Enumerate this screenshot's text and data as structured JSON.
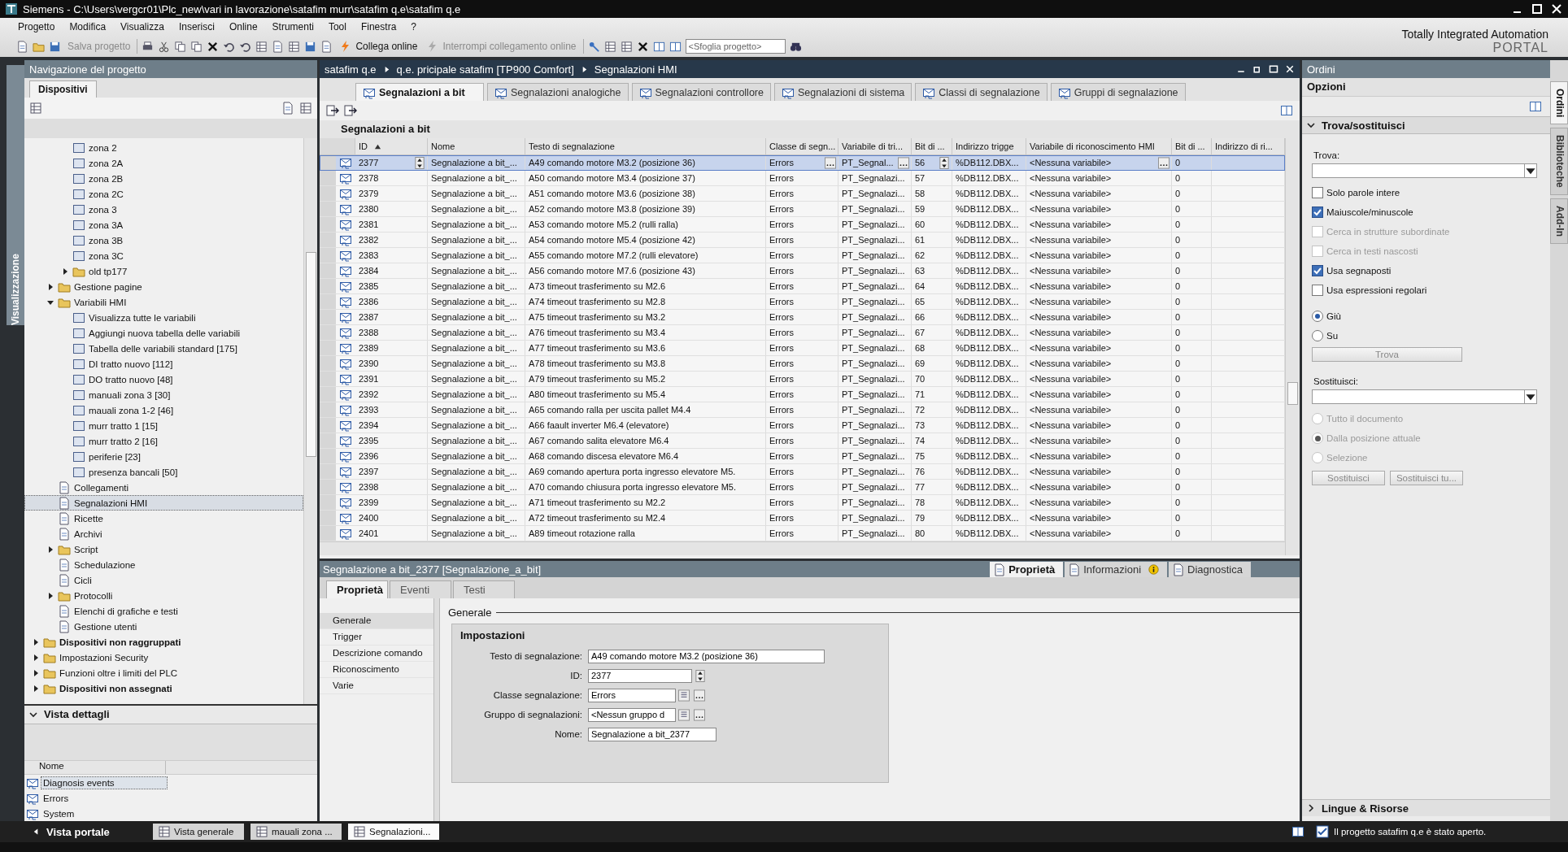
{
  "window": {
    "title": "Siemens  -  C:\\Users\\vergcr01\\Plc_new\\vari in lavorazione\\satafim murr\\satafim q.e\\satafim q.e"
  },
  "menu": [
    "Progetto",
    "Modifica",
    "Visualizza",
    "Inserisci",
    "Online",
    "Strumenti",
    "Tool",
    "Finestra",
    "?"
  ],
  "toolbar": {
    "items": [
      {
        "label": "Salva progetto",
        "disabled": true
      },
      {
        "label": "Collega online",
        "disabled": false
      },
      {
        "label": "Interrompi collegamento online",
        "disabled": true
      }
    ],
    "search": {
      "placeholder": "<Sfoglia progetto>"
    }
  },
  "brand": {
    "line1": "Totally Integrated Automation",
    "line2": "PORTAL"
  },
  "side_strip": {
    "label": "Visualizzazione"
  },
  "navigation": {
    "title": "Navigazione del progetto",
    "tab": "Dispositivi",
    "tree": [
      {
        "children": [
          {
            "children": [
              {
                "label": "zona 2",
                "selected": false
              },
              {
                "label": "zona 2A",
                "selected": false
              },
              {
                "label": "zona 2B",
                "selected": false
              },
              {
                "label": "zona 2C",
                "selected": false
              },
              {
                "label": "zona 3",
                "selected": false
              },
              {
                "label": "zona 3A",
                "selected": false
              },
              {
                "label": "zona 3B",
                "selected": false
              },
              {
                "label": "zona 3C",
                "selected": false
              },
              {
                "label": "old tp177",
                "expanded": false,
                "selected": false
              }
            ]
          },
          {
            "label": "Gestione pagine",
            "expanded": false,
            "selected": false
          },
          {
            "label": "Variabili HMI",
            "expanded": true,
            "selected": false,
            "children": [
              {
                "label": "Visualizza tutte le variabili",
                "selected": false
              },
              {
                "label": "Aggiungi nuova tabella delle variabili",
                "selected": false
              },
              {
                "label": "Tabella delle variabili standard [175]",
                "selected": false
              },
              {
                "label": "DI tratto nuovo [112]",
                "selected": false
              },
              {
                "label": "DO tratto nuovo [48]",
                "selected": false
              },
              {
                "label": "manuali zona 3 [30]",
                "selected": false
              },
              {
                "label": "mauali zona 1-2 [46]",
                "selected": false
              },
              {
                "label": "murr tratto 1 [15]",
                "selected": false
              },
              {
                "label": "murr tratto 2 [16]",
                "selected": false
              },
              {
                "label": "periferie [23]",
                "selected": false
              },
              {
                "label": "presenza bancali [50]",
                "selected": false
              }
            ]
          },
          {
            "label": "Collegamenti",
            "selected": false
          },
          {
            "label": "Segnalazioni HMI",
            "selected": true
          },
          {
            "label": "Ricette",
            "selected": false
          },
          {
            "label": "Archivi",
            "selected": false
          },
          {
            "label": "Script",
            "expanded": false,
            "selected": false
          },
          {
            "label": "Schedulazione",
            "selected": false
          },
          {
            "label": "Cicli",
            "selected": false
          },
          {
            "label": "Protocolli",
            "expanded": false,
            "selected": false
          },
          {
            "label": "Elenchi di grafiche e testi",
            "selected": false
          },
          {
            "label": "Gestione utenti",
            "selected": false
          }
        ]
      },
      {
        "label": "Dispositivi non raggruppati",
        "bold": true,
        "expanded": false,
        "selected": false
      },
      {
        "label": "Impostazioni Security",
        "bold": false,
        "expanded": false,
        "selected": false
      },
      {
        "label": "Funzioni oltre i limiti del PLC",
        "bold": false,
        "expanded": false,
        "selected": false
      },
      {
        "label": "Dispositivi non assegnati",
        "bold": true,
        "expanded": false,
        "selected": false
      }
    ]
  },
  "details": {
    "title": "Vista dettagli",
    "column": "Nome",
    "rows": [
      {
        "label": "Diagnosis events",
        "selected": true
      },
      {
        "label": "Errors",
        "selected": false
      },
      {
        "label": "System",
        "selected": false
      }
    ]
  },
  "editor": {
    "breadcrumb": [
      "satafim q.e",
      "q.e. pricipale satafim [TP900 Comfort]",
      "Segnalazioni HMI"
    ],
    "tabs": [
      {
        "label": "Segnalazioni a bit",
        "selected": true
      },
      {
        "label": "Segnalazioni analogiche",
        "selected": false
      },
      {
        "label": "Segnalazioni controllore",
        "selected": false
      },
      {
        "label": "Segnalazioni di sistema",
        "selected": false
      },
      {
        "label": "Classi di segnalazione",
        "selected": false
      },
      {
        "label": "Gruppi di segnalazione",
        "selected": false
      }
    ],
    "caption": "Segnalazioni a bit"
  },
  "table": {
    "columns": [
      "ID",
      "Nome",
      "Testo di segnalazione",
      "Classe di segn...",
      "Variabile di tri...",
      "Bit di ...",
      "Indirizzo trigge",
      "Variabile di riconoscimento HMI",
      "Bit di ...",
      "Indirizzo di ri..."
    ],
    "rows": [
      {
        "selected": true,
        "id": "2377",
        "name": "Segnalazione a bit_...",
        "text": "A49 comando motore M3.2 (posizione 36)",
        "class": "Errors",
        "trigger_tag": "PT_Segnal...",
        "trigger_bit": "56",
        "trigger_address": "%DB112.DBX...",
        "ack_tag": "<Nessuna variabile>",
        "ack_bit": "0"
      },
      {
        "selected": false,
        "id": "2378",
        "name": "Segnalazione a bit_...",
        "text": "A50 comando motore M3.4 (posizione 37)",
        "class": "Errors",
        "trigger_tag": "PT_Segnalazi...",
        "trigger_bit": "57",
        "trigger_address": "%DB112.DBX...",
        "ack_tag": "<Nessuna variabile>",
        "ack_bit": "0"
      },
      {
        "selected": false,
        "id": "2379",
        "name": "Segnalazione a bit_...",
        "text": "A51 comando motore M3.6 (posizione 38)",
        "class": "Errors",
        "trigger_tag": "PT_Segnalazi...",
        "trigger_bit": "58",
        "trigger_address": "%DB112.DBX...",
        "ack_tag": "<Nessuna variabile>",
        "ack_bit": "0"
      },
      {
        "selected": false,
        "id": "2380",
        "name": "Segnalazione a bit_...",
        "text": "A52 comando motore M3.8 (posizione 39)",
        "class": "Errors",
        "trigger_tag": "PT_Segnalazi...",
        "trigger_bit": "59",
        "trigger_address": "%DB112.DBX...",
        "ack_tag": "<Nessuna variabile>",
        "ack_bit": "0"
      },
      {
        "selected": false,
        "id": "2381",
        "name": "Segnalazione a bit_...",
        "text": "A53 comando motore M5.2 (rulli ralla)",
        "class": "Errors",
        "trigger_tag": "PT_Segnalazi...",
        "trigger_bit": "60",
        "trigger_address": "%DB112.DBX...",
        "ack_tag": "<Nessuna variabile>",
        "ack_bit": "0"
      },
      {
        "selected": false,
        "id": "2382",
        "name": "Segnalazione a bit_...",
        "text": "A54 comando motore M5.4 (posizione 42)",
        "class": "Errors",
        "trigger_tag": "PT_Segnalazi...",
        "trigger_bit": "61",
        "trigger_address": "%DB112.DBX...",
        "ack_tag": "<Nessuna variabile>",
        "ack_bit": "0"
      },
      {
        "selected": false,
        "id": "2383",
        "name": "Segnalazione a bit_...",
        "text": "A55 comando motore M7.2 (rulli elevatore)",
        "class": "Errors",
        "trigger_tag": "PT_Segnalazi...",
        "trigger_bit": "62",
        "trigger_address": "%DB112.DBX...",
        "ack_tag": "<Nessuna variabile>",
        "ack_bit": "0"
      },
      {
        "selected": false,
        "id": "2384",
        "name": "Segnalazione a bit_...",
        "text": "A56 comando motore M7.6 (posizione 43)",
        "class": "Errors",
        "trigger_tag": "PT_Segnalazi...",
        "trigger_bit": "63",
        "trigger_address": "%DB112.DBX...",
        "ack_tag": "<Nessuna variabile>",
        "ack_bit": "0"
      },
      {
        "selected": false,
        "id": "2385",
        "name": "Segnalazione a bit_...",
        "text": "A73 timeout trasferimento su M2.6",
        "class": "Errors",
        "trigger_tag": "PT_Segnalazi...",
        "trigger_bit": "64",
        "trigger_address": "%DB112.DBX...",
        "ack_tag": "<Nessuna variabile>",
        "ack_bit": "0"
      },
      {
        "selected": false,
        "id": "2386",
        "name": "Segnalazione a bit_...",
        "text": "A74 timeout trasferimento su M2.8",
        "class": "Errors",
        "trigger_tag": "PT_Segnalazi...",
        "trigger_bit": "65",
        "trigger_address": "%DB112.DBX...",
        "ack_tag": "<Nessuna variabile>",
        "ack_bit": "0"
      },
      {
        "selected": false,
        "id": "2387",
        "name": "Segnalazione a bit_...",
        "text": "A75 timeout trasferimento su M3.2",
        "class": "Errors",
        "trigger_tag": "PT_Segnalazi...",
        "trigger_bit": "66",
        "trigger_address": "%DB112.DBX...",
        "ack_tag": "<Nessuna variabile>",
        "ack_bit": "0"
      },
      {
        "selected": false,
        "id": "2388",
        "name": "Segnalazione a bit_...",
        "text": "A76 timeout trasferimento su M3.4",
        "class": "Errors",
        "trigger_tag": "PT_Segnalazi...",
        "trigger_bit": "67",
        "trigger_address": "%DB112.DBX...",
        "ack_tag": "<Nessuna variabile>",
        "ack_bit": "0"
      },
      {
        "selected": false,
        "id": "2389",
        "name": "Segnalazione a bit_...",
        "text": "A77 timeout trasferimento su M3.6",
        "class": "Errors",
        "trigger_tag": "PT_Segnalazi...",
        "trigger_bit": "68",
        "trigger_address": "%DB112.DBX...",
        "ack_tag": "<Nessuna variabile>",
        "ack_bit": "0"
      },
      {
        "selected": false,
        "id": "2390",
        "name": "Segnalazione a bit_...",
        "text": "A78 timeout trasferimento su M3.8",
        "class": "Errors",
        "trigger_tag": "PT_Segnalazi...",
        "trigger_bit": "69",
        "trigger_address": "%DB112.DBX...",
        "ack_tag": "<Nessuna variabile>",
        "ack_bit": "0"
      },
      {
        "selected": false,
        "id": "2391",
        "name": "Segnalazione a bit_...",
        "text": "A79 timeout trasferimento su M5.2",
        "class": "Errors",
        "trigger_tag": "PT_Segnalazi...",
        "trigger_bit": "70",
        "trigger_address": "%DB112.DBX...",
        "ack_tag": "<Nessuna variabile>",
        "ack_bit": "0"
      },
      {
        "selected": false,
        "id": "2392",
        "name": "Segnalazione a bit_...",
        "text": "A80 timeout trasferimento su M5.4",
        "class": "Errors",
        "trigger_tag": "PT_Segnalazi...",
        "trigger_bit": "71",
        "trigger_address": "%DB112.DBX...",
        "ack_tag": "<Nessuna variabile>",
        "ack_bit": "0"
      },
      {
        "selected": false,
        "id": "2393",
        "name": "Segnalazione a bit_...",
        "text": "A65 comando ralla per uscita pallet M4.4",
        "class": "Errors",
        "trigger_tag": "PT_Segnalazi...",
        "trigger_bit": "72",
        "trigger_address": "%DB112.DBX...",
        "ack_tag": "<Nessuna variabile>",
        "ack_bit": "0"
      },
      {
        "selected": false,
        "id": "2394",
        "name": "Segnalazione a bit_...",
        "text": "A66 faault inverter M6.4 (elevatore)",
        "class": "Errors",
        "trigger_tag": "PT_Segnalazi...",
        "trigger_bit": "73",
        "trigger_address": "%DB112.DBX...",
        "ack_tag": "<Nessuna variabile>",
        "ack_bit": "0"
      },
      {
        "selected": false,
        "id": "2395",
        "name": "Segnalazione a bit_...",
        "text": "A67 comando salita elevatore M6.4",
        "class": "Errors",
        "trigger_tag": "PT_Segnalazi...",
        "trigger_bit": "74",
        "trigger_address": "%DB112.DBX...",
        "ack_tag": "<Nessuna variabile>",
        "ack_bit": "0"
      },
      {
        "selected": false,
        "id": "2396",
        "name": "Segnalazione a bit_...",
        "text": "A68 comando discesa elevatore M6.4",
        "class": "Errors",
        "trigger_tag": "PT_Segnalazi...",
        "trigger_bit": "75",
        "trigger_address": "%DB112.DBX...",
        "ack_tag": "<Nessuna variabile>",
        "ack_bit": "0"
      },
      {
        "selected": false,
        "id": "2397",
        "name": "Segnalazione a bit_...",
        "text": "A69 comando apertura porta ingresso  elevatore M5.",
        "class": "Errors",
        "trigger_tag": "PT_Segnalazi...",
        "trigger_bit": "76",
        "trigger_address": "%DB112.DBX...",
        "ack_tag": "<Nessuna variabile>",
        "ack_bit": "0"
      },
      {
        "selected": false,
        "id": "2398",
        "name": "Segnalazione a bit_...",
        "text": "A70 comando chiusura porta ingresso  elevatore M5.",
        "class": "Errors",
        "trigger_tag": "PT_Segnalazi...",
        "trigger_bit": "77",
        "trigger_address": "%DB112.DBX...",
        "ack_tag": "<Nessuna variabile>",
        "ack_bit": "0"
      },
      {
        "selected": false,
        "id": "2399",
        "name": "Segnalazione a bit_...",
        "text": "A71 timeout trasferimento su M2.2",
        "class": "Errors",
        "trigger_tag": "PT_Segnalazi...",
        "trigger_bit": "78",
        "trigger_address": "%DB112.DBX...",
        "ack_tag": "<Nessuna variabile>",
        "ack_bit": "0"
      },
      {
        "selected": false,
        "id": "2400",
        "name": "Segnalazione a bit_...",
        "text": "A72 timeout trasferimento su M2.4",
        "class": "Errors",
        "trigger_tag": "PT_Segnalazi...",
        "trigger_bit": "79",
        "trigger_address": "%DB112.DBX...",
        "ack_tag": "<Nessuna variabile>",
        "ack_bit": "0"
      },
      {
        "selected": false,
        "id": "2401",
        "name": "Segnalazione a bit_...",
        "text": "A89 timeout rotazione ralla",
        "class": "Errors",
        "trigger_tag": "PT_Segnalazi...",
        "trigger_bit": "80",
        "trigger_address": "%DB112.DBX...",
        "ack_tag": "<Nessuna variabile>",
        "ack_bit": "0"
      }
    ]
  },
  "inspector": {
    "title": "Segnalazione a bit_2377 [Segnalazione_a_bit]",
    "tabs": [
      {
        "label": "Proprietà",
        "selected": true,
        "info": false
      },
      {
        "label": "Informazioni",
        "selected": false,
        "info": true
      },
      {
        "label": "Diagnostica",
        "selected": false,
        "info": false
      }
    ],
    "subtabs": [
      {
        "label": "Proprietà",
        "selected": true
      },
      {
        "label": "Eventi",
        "selected": false
      },
      {
        "label": "Testi",
        "selected": false
      }
    ],
    "sections": [
      {
        "label": "Generale",
        "selected": true
      },
      {
        "label": "Trigger",
        "selected": false
      },
      {
        "label": "Descrizione comando",
        "selected": false
      },
      {
        "label": "Riconoscimento",
        "selected": false
      },
      {
        "label": "Varie",
        "selected": false
      }
    ],
    "heading": "Generale",
    "group": "Impostazioni",
    "fields": [
      {
        "label": "Testo di segnalazione:",
        "value": "A49 comando motore M3.2 (posizione 36)",
        "kind": "text"
      },
      {
        "label": "ID:",
        "value": "2377",
        "kind": "spin"
      },
      {
        "label": "Classe segnalazione:",
        "value": "Errors",
        "kind": "pick"
      },
      {
        "label": "Gruppo di segnalazioni:",
        "value": "<Nessun gruppo d",
        "kind": "pick"
      },
      {
        "label": "Nome:",
        "value": "Segnalazione a bit_2377",
        "kind": "short"
      }
    ]
  },
  "tasks": {
    "title": "Ordini",
    "options": "Opzioni",
    "section": "Trova/sostituisci",
    "find_label": "Trova:",
    "checkboxes": [
      {
        "label": "Solo parole intere",
        "checked": false,
        "disabled": false
      },
      {
        "label": "Maiuscole/minuscole",
        "checked": true,
        "disabled": false
      },
      {
        "label": "Cerca in strutture subordinate",
        "checked": false,
        "disabled": true
      },
      {
        "label": "Cerca in testi nascosti",
        "checked": false,
        "disabled": true
      },
      {
        "label": "Usa segnaposti",
        "checked": true,
        "disabled": false
      },
      {
        "label": "Usa espressioni regolari",
        "checked": false,
        "disabled": false
      }
    ],
    "direction": [
      {
        "label": "Giù",
        "selected": true,
        "disabled": false
      },
      {
        "label": "Su",
        "selected": false,
        "disabled": false
      }
    ],
    "find_button": "Trova",
    "replace_label": "Sostituisci:",
    "scope": [
      {
        "label": "Tutto il documento",
        "selected": false,
        "disabled": true
      },
      {
        "label": "Dalla posizione attuale",
        "selected": true,
        "disabled": true
      },
      {
        "label": "Selezione",
        "selected": false,
        "disabled": true
      }
    ],
    "buttons": [
      "Sostituisci",
      "Sostituisci tu..."
    ],
    "footer": "Lingue & Risorse"
  },
  "side_tabs": [
    {
      "label": "Ordini",
      "selected": true
    },
    {
      "label": "Biblioteche",
      "selected": false
    },
    {
      "label": "Add-In",
      "selected": false
    }
  ],
  "taskbar": {
    "portal": "Vista portale",
    "items": [
      {
        "label": "Vista generale",
        "selected": false
      },
      {
        "label": "mauali zona ...",
        "selected": false
      },
      {
        "label": "Segnalazioni...",
        "selected": true
      }
    ],
    "status": "Il progetto satafim q.e è stato aperto."
  }
}
